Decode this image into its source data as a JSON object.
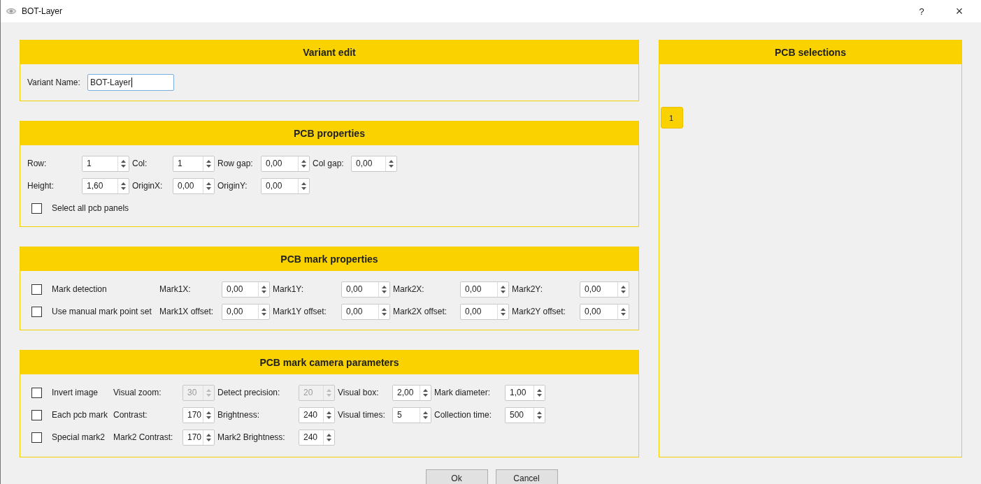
{
  "window": {
    "title": "BOT-Layer",
    "help": "?",
    "close": "×"
  },
  "sections": [
    {
      "title": "Variant edit",
      "rows": [
        [
          {
            "kind": "text",
            "label": "Variant Name:",
            "value": "BOT-Layer"
          }
        ]
      ]
    },
    {
      "title": "PCB properties",
      "rows": [
        [
          {
            "kind": "spin",
            "label": "Row:",
            "value": "1",
            "disabled": false
          },
          {
            "kind": "spin",
            "label": "Col:",
            "value": "1",
            "disabled": false
          },
          {
            "kind": "spin",
            "label": "Row gap:",
            "value": "0,00",
            "disabled": false
          },
          {
            "kind": "spin",
            "label": "Col gap:",
            "value": "0,00",
            "disabled": false
          }
        ],
        [
          {
            "kind": "spin",
            "label": "Height:",
            "value": "1,60",
            "disabled": false
          },
          {
            "kind": "spin",
            "label": "OriginX:",
            "value": "0,00",
            "disabled": false
          },
          {
            "kind": "spin",
            "label": "OriginY:",
            "value": "0,00",
            "disabled": false
          }
        ],
        [
          {
            "kind": "check",
            "label": "Select all pcb panels",
            "checked": false
          }
        ]
      ]
    },
    {
      "title": "PCB mark properties",
      "rows": [
        [
          {
            "kind": "check",
            "label": "Mark detection",
            "checked": false
          },
          {
            "kind": "spin",
            "label": "Mark1X:",
            "value": "0,00",
            "disabled": false
          },
          {
            "kind": "spin",
            "label": "Mark1Y:",
            "value": "0,00",
            "disabled": false
          },
          {
            "kind": "spin",
            "label": "Mark2X:",
            "value": "0,00",
            "disabled": false
          },
          {
            "kind": "spin",
            "label": "Mark2Y:",
            "value": "0,00",
            "disabled": false
          }
        ],
        [
          {
            "kind": "check",
            "label": "Use manual mark point set",
            "checked": false
          },
          {
            "kind": "spin",
            "label": "Mark1X offset:",
            "value": "0,00",
            "disabled": false
          },
          {
            "kind": "spin",
            "label": "Mark1Y offset:",
            "value": "0,00",
            "disabled": false
          },
          {
            "kind": "spin",
            "label": "Mark2X offset:",
            "value": "0,00",
            "disabled": false
          },
          {
            "kind": "spin",
            "label": "Mark2Y offset:",
            "value": "0,00",
            "disabled": false
          }
        ]
      ]
    },
    {
      "title": "PCB mark camera parameters",
      "rows": [
        [
          {
            "kind": "check",
            "label": "Invert image",
            "checked": false
          },
          {
            "kind": "spin",
            "label": "Visual zoom:",
            "value": "30",
            "disabled": true
          },
          {
            "kind": "spin",
            "label": "Detect precision:",
            "value": "20",
            "disabled": true
          },
          {
            "kind": "spin",
            "label": "Visual box:",
            "value": "2,00",
            "disabled": false
          },
          {
            "kind": "spin",
            "label": "Mark diameter:",
            "value": "1,00",
            "disabled": false
          }
        ],
        [
          {
            "kind": "check",
            "label": "Each pcb mark",
            "checked": false
          },
          {
            "kind": "spin",
            "label": "Contrast:",
            "value": "170",
            "disabled": false
          },
          {
            "kind": "spin",
            "label": "Brightness:",
            "value": "240",
            "disabled": false
          },
          {
            "kind": "spin",
            "label": "Visual times:",
            "value": "5",
            "disabled": false
          },
          {
            "kind": "spin",
            "label": "Collection time:",
            "value": "500",
            "disabled": false
          }
        ],
        [
          {
            "kind": "check",
            "label": "Special mark2",
            "checked": false
          },
          {
            "kind": "spin",
            "label": "Mark2 Contrast:",
            "value": "170",
            "disabled": false
          },
          {
            "kind": "spin",
            "label": "Mark2 Brightness:",
            "value": "240",
            "disabled": false
          }
        ]
      ]
    }
  ],
  "side_panel": {
    "title": "PCB selections",
    "items": [
      {
        "label": "1"
      }
    ]
  },
  "buttons": [
    {
      "label": "Ok"
    },
    {
      "label": "Cancel"
    }
  ]
}
